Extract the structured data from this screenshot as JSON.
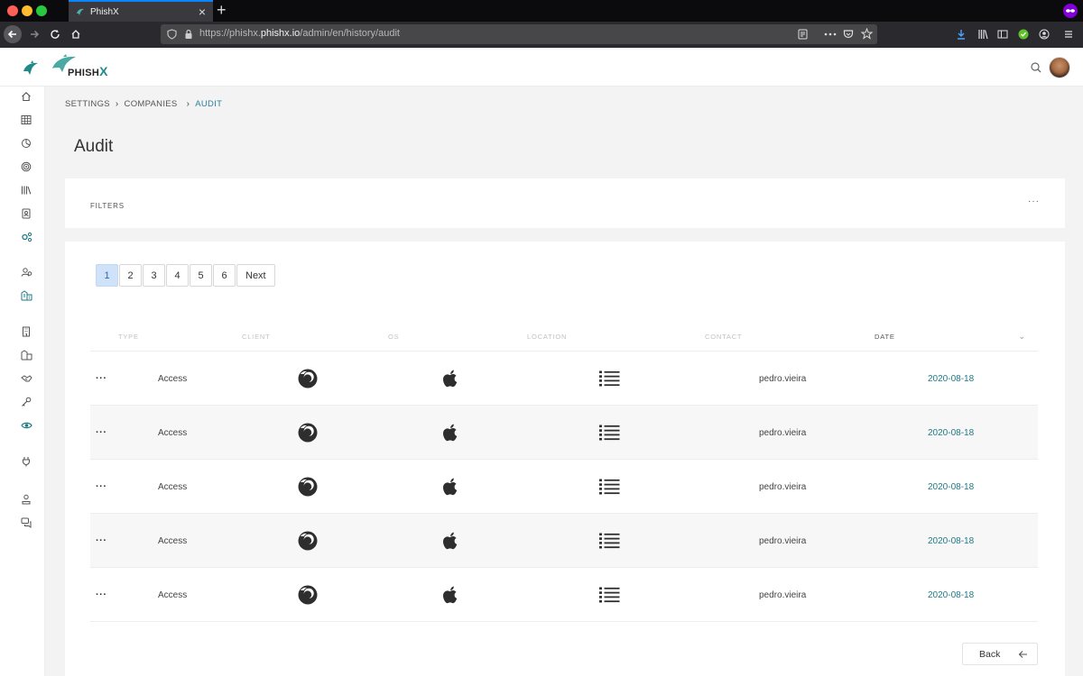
{
  "browser": {
    "tab_title": "PhishX",
    "url_prefix": "https://phishx.",
    "url_domain": "phishx.io",
    "url_path": "/admin/en/history/audit"
  },
  "app": {
    "logo_text": "PHISH",
    "logo_x": "X"
  },
  "breadcrumb": {
    "items": [
      "SETTINGS",
      "COMPANIES",
      "AUDIT"
    ]
  },
  "page": {
    "title": "Audit"
  },
  "filters": {
    "label": "FILTERS",
    "more": "···"
  },
  "pagination": {
    "pages": [
      "1",
      "2",
      "3",
      "4",
      "5",
      "6"
    ],
    "active": "1",
    "next_label": "Next"
  },
  "table": {
    "columns": [
      "TYPE",
      "CLIENT",
      "OS",
      "LOCATION",
      "CONTACT",
      "DATE"
    ],
    "sorted_column": "DATE",
    "rows": [
      {
        "menu": "···",
        "type": "Access",
        "client_icon": "firefox-icon",
        "os_icon": "apple-icon",
        "location_icon": "list-icon",
        "contact": "pedro.vieira",
        "date": "2020-08-18"
      },
      {
        "menu": "···",
        "type": "Access",
        "client_icon": "firefox-icon",
        "os_icon": "apple-icon",
        "location_icon": "list-icon",
        "contact": "pedro.vieira",
        "date": "2020-08-18"
      },
      {
        "menu": "···",
        "type": "Access",
        "client_icon": "firefox-icon",
        "os_icon": "apple-icon",
        "location_icon": "list-icon",
        "contact": "pedro.vieira",
        "date": "2020-08-18"
      },
      {
        "menu": "···",
        "type": "Access",
        "client_icon": "firefox-icon",
        "os_icon": "apple-icon",
        "location_icon": "list-icon",
        "contact": "pedro.vieira",
        "date": "2020-08-18"
      },
      {
        "menu": "···",
        "type": "Access",
        "client_icon": "firefox-icon",
        "os_icon": "apple-icon",
        "location_icon": "list-icon",
        "contact": "pedro.vieira",
        "date": "2020-08-18"
      }
    ]
  },
  "footer": {
    "back_label": "Back"
  },
  "colors": {
    "accent": "#1e7a85",
    "active_page_bg": "#cfe2f8",
    "link": "#2a7f9e"
  }
}
